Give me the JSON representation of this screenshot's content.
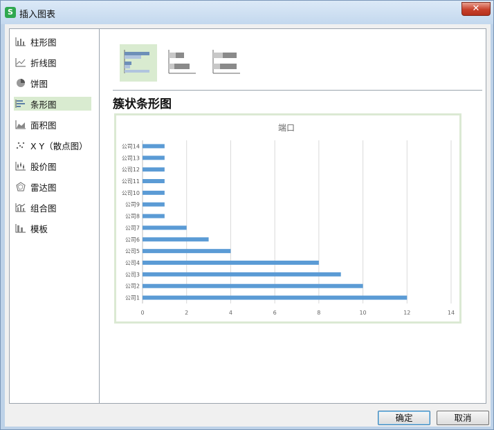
{
  "window": {
    "title": "插入图表",
    "app_icon": "S",
    "close_glyph": "✕"
  },
  "sidebar": {
    "items": [
      {
        "label": "柱形图",
        "icon": "column-chart-icon"
      },
      {
        "label": "折线图",
        "icon": "line-chart-icon"
      },
      {
        "label": "饼图",
        "icon": "pie-chart-icon"
      },
      {
        "label": "条形图",
        "icon": "bar-chart-icon",
        "selected": true
      },
      {
        "label": "面积图",
        "icon": "area-chart-icon"
      },
      {
        "label": "X Y（散点图）",
        "icon": "scatter-chart-icon"
      },
      {
        "label": "股价图",
        "icon": "stock-chart-icon"
      },
      {
        "label": "雷达图",
        "icon": "radar-chart-icon"
      },
      {
        "label": "组合图",
        "icon": "combo-chart-icon"
      },
      {
        "label": "模板",
        "icon": "template-icon"
      }
    ]
  },
  "subtypes": [
    {
      "name": "clustered-bar",
      "selected": true
    },
    {
      "name": "stacked-bar",
      "selected": false
    },
    {
      "name": "percent-stacked-bar",
      "selected": false
    }
  ],
  "main": {
    "subtype_title": "簇状条形图"
  },
  "chart_data": {
    "type": "bar",
    "orientation": "horizontal",
    "title": "端口",
    "categories": [
      "公司1",
      "公司2",
      "公司3",
      "公司4",
      "公司5",
      "公司6",
      "公司7",
      "公司8",
      "公司9",
      "公司10",
      "公司11",
      "公司12",
      "公司13",
      "公司14"
    ],
    "values": [
      12,
      10,
      9,
      8,
      4,
      3,
      2,
      1,
      1,
      1,
      1,
      1,
      1,
      1
    ],
    "xlim": [
      0,
      14
    ],
    "xticks": [
      "0",
      "2",
      "4",
      "6",
      "8",
      "10",
      "12",
      "14"
    ],
    "grid": true,
    "bar_color": "#5b9bd5"
  },
  "buttons": {
    "ok": "确定",
    "cancel": "取消"
  },
  "colors": {
    "selection": "#d9ebd0",
    "bar": "#5b9bd5"
  }
}
